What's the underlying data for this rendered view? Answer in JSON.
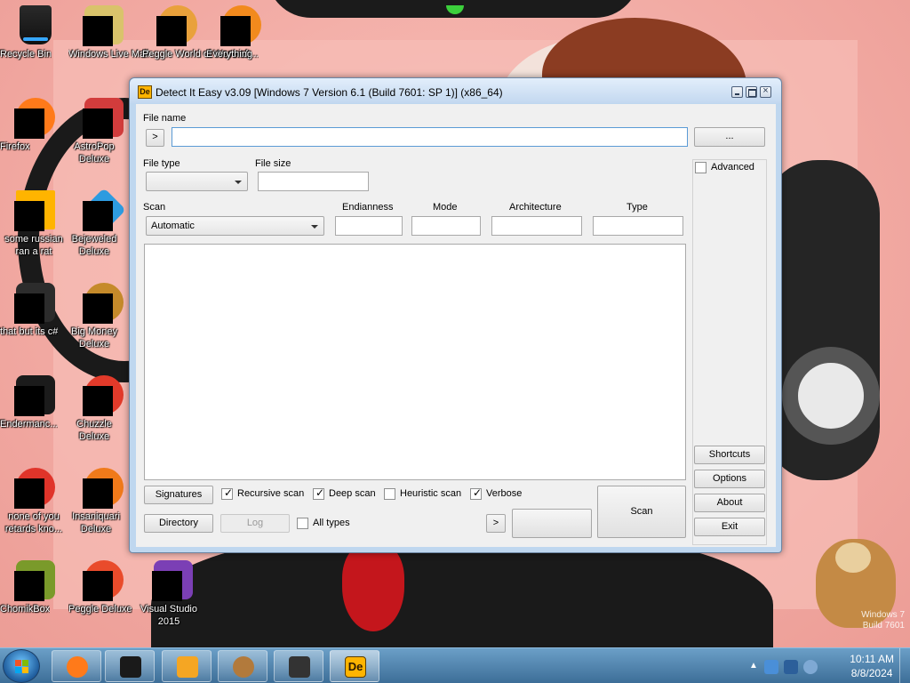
{
  "desktop": {
    "icons": [
      {
        "label": "Recycle Bin"
      },
      {
        "label": "Windows Live Mail"
      },
      {
        "label": "Peggle World of Warcraft..."
      },
      {
        "label": "Everything"
      },
      {
        "label": "Firefox"
      },
      {
        "label": "AstroPop Deluxe"
      },
      {
        "label": "some russian ran a rat"
      },
      {
        "label": "Bejeweled Deluxe"
      },
      {
        "label": "that but its c#"
      },
      {
        "label": "Big Money Deluxe"
      },
      {
        "label": "Endermanc..."
      },
      {
        "label": "Chuzzle Deluxe"
      },
      {
        "label": "none of you retards kno..."
      },
      {
        "label": "Insaniquari Deluxe"
      },
      {
        "label": "ChomikBox"
      },
      {
        "label": "Peggle Deluxe"
      },
      {
        "label": "Visual Studio 2015"
      }
    ],
    "watermark": [
      "Windows 7",
      "Build 7601"
    ]
  },
  "window": {
    "app_icon_text": "De",
    "title": "Detect It Easy v3.09 [Windows 7 Version 6.1 (Build 7601: SP 1)] (x86_64)",
    "file_name_label": "File name",
    "file_name_value": "",
    "recent_button": ">",
    "browse_button": "...",
    "file_type_label": "File type",
    "file_type_value": "",
    "file_size_label": "File size",
    "file_size_value": "",
    "advanced_label": "Advanced",
    "advanced_checked": false,
    "scan_label": "Scan",
    "scan_value": "Automatic",
    "endianness_label": "Endianness",
    "endianness_value": "",
    "mode_label": "Mode",
    "mode_value": "",
    "architecture_label": "Architecture",
    "architecture_value": "",
    "type_label": "Type",
    "type_value": "",
    "side_buttons": {
      "shortcuts": "Shortcuts",
      "options": "Options",
      "about": "About",
      "exit": "Exit"
    },
    "signatures_button": "Signatures",
    "directory_button": "Directory",
    "log_button": "Log",
    "recursive_scan": {
      "label": "Recursive scan",
      "checked": true
    },
    "deep_scan": {
      "label": "Deep scan",
      "checked": true
    },
    "heuristic_scan": {
      "label": "Heuristic scan",
      "checked": false
    },
    "verbose": {
      "label": "Verbose",
      "checked": true
    },
    "all_types": {
      "label": "All types",
      "checked": false
    },
    "next_button": ">",
    "scan_button": "Scan",
    "check_mark": "✓"
  },
  "taskbar": {
    "items": [
      "firefox-icon",
      "terminal-icon",
      "media-player-icon",
      "hamster-icon",
      "warning-icon",
      "die-icon"
    ],
    "die_icon_text": "De",
    "tray_arrow": "▲",
    "time": "10:11 AM",
    "date": "8/8/2024"
  }
}
